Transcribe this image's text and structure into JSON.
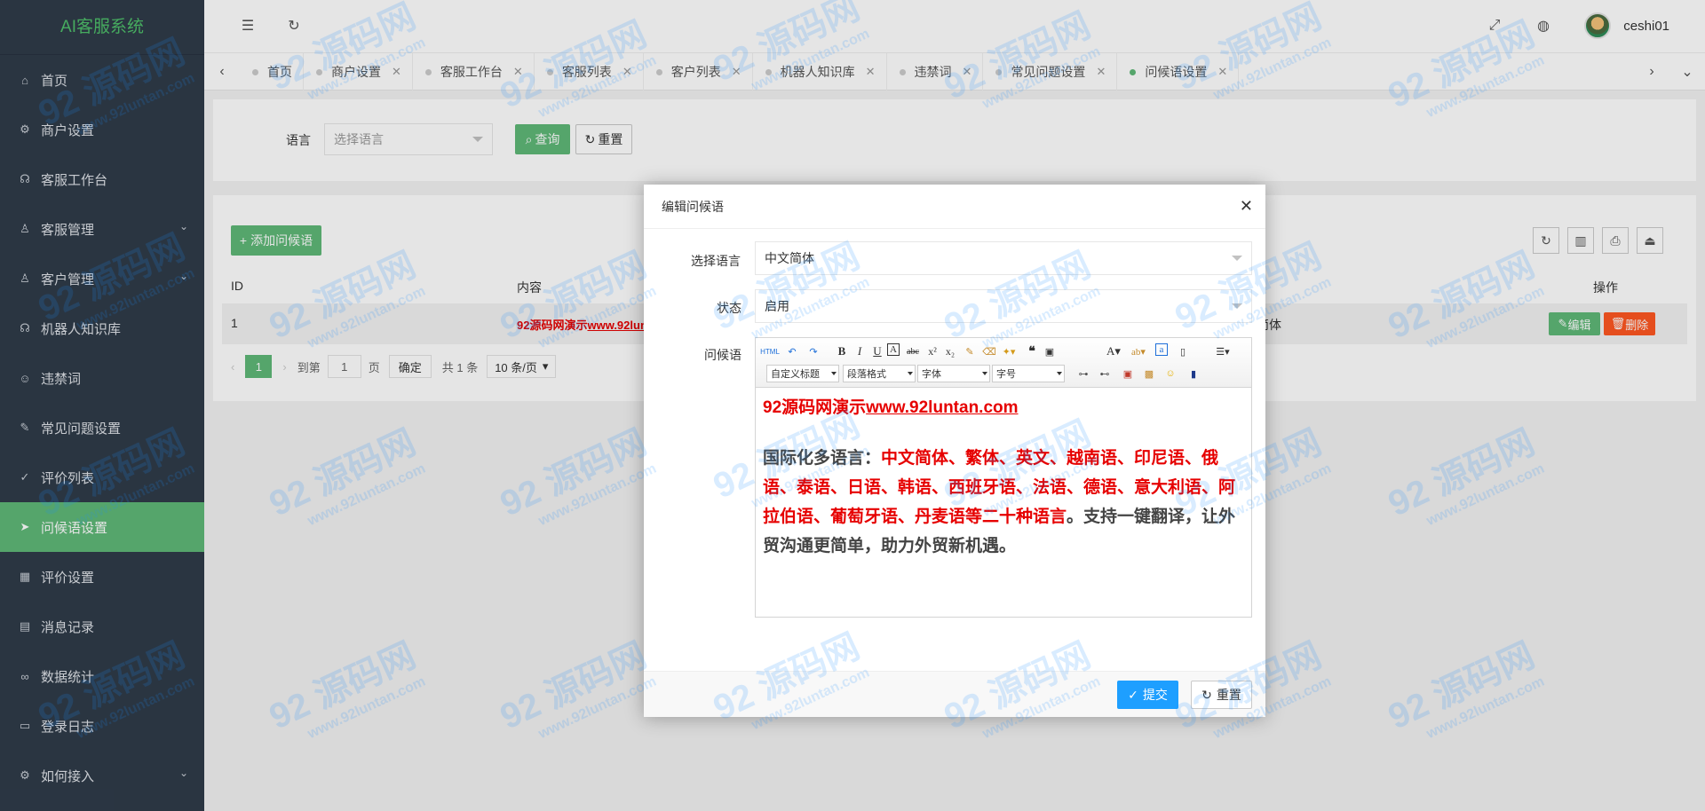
{
  "app": {
    "title": "AI客服系统"
  },
  "sidebar": {
    "items": [
      {
        "label": "首页",
        "icon": "home-icon",
        "glyph": "⌂",
        "has_children": false
      },
      {
        "label": "商户设置",
        "icon": "gear-icon",
        "glyph": "⚙",
        "has_children": false
      },
      {
        "label": "客服工作台",
        "icon": "headset-icon",
        "glyph": "☊",
        "has_children": false
      },
      {
        "label": "客服管理",
        "icon": "user-icon",
        "glyph": "♙",
        "has_children": true
      },
      {
        "label": "客户管理",
        "icon": "users-icon",
        "glyph": "♙",
        "has_children": true
      },
      {
        "label": "机器人知识库",
        "icon": "robot-icon",
        "glyph": "☊",
        "has_children": false
      },
      {
        "label": "违禁词",
        "icon": "smile-icon",
        "glyph": "☺",
        "has_children": false
      },
      {
        "label": "常见问题设置",
        "icon": "edit-icon",
        "glyph": "✎",
        "has_children": false
      },
      {
        "label": "评价列表",
        "icon": "thumb-icon",
        "glyph": "✓",
        "has_children": false
      },
      {
        "label": "问候语设置",
        "icon": "send-icon",
        "glyph": "➤",
        "has_children": false,
        "active": true
      },
      {
        "label": "评价设置",
        "icon": "calendar-icon",
        "glyph": "▦",
        "has_children": false
      },
      {
        "label": "消息记录",
        "icon": "note-icon",
        "glyph": "▤",
        "has_children": false
      },
      {
        "label": "数据统计",
        "icon": "link-icon",
        "glyph": "∞",
        "has_children": false
      },
      {
        "label": "登录日志",
        "icon": "log-icon",
        "glyph": "▭",
        "has_children": false
      },
      {
        "label": "如何接入",
        "icon": "plug-icon",
        "glyph": "⚙",
        "has_children": true
      }
    ]
  },
  "header": {
    "username": "ceshi01"
  },
  "tabs": [
    {
      "label": "首页",
      "closable": false
    },
    {
      "label": "商户设置",
      "closable": true
    },
    {
      "label": "客服工作台",
      "closable": true
    },
    {
      "label": "客服列表",
      "closable": true
    },
    {
      "label": "客户列表",
      "closable": true
    },
    {
      "label": "机器人知识库",
      "closable": true
    },
    {
      "label": "违禁词",
      "closable": true
    },
    {
      "label": "常见问题设置",
      "closable": true
    },
    {
      "label": "问候语设置",
      "closable": true,
      "active": true
    }
  ],
  "search": {
    "language_label": "语言",
    "language_placeholder": "选择语言",
    "query_button": "查询",
    "reset_button": "重置"
  },
  "list": {
    "add_button": "添加问候语",
    "columns": {
      "id": "ID",
      "content": "内容",
      "action": "操作"
    },
    "rows": [
      {
        "id": "1",
        "content": "92源码网演示",
        "content_link": "www.92lun",
        "language": "简体",
        "edit": "编辑",
        "delete": "删除"
      }
    ],
    "pager": {
      "current": "1",
      "goto_label": "到第",
      "page_input": "1",
      "page_unit": "页",
      "confirm": "确定",
      "total": "共 1 条",
      "per_page": "10 条/页"
    }
  },
  "modal": {
    "title": "编辑问候语",
    "language_label": "选择语言",
    "language_value": "中文简体",
    "status_label": "状态",
    "status_value": "启用",
    "greeting_label": "问候语",
    "editor": {
      "toolbar_combos": [
        "自定义标题",
        "段落格式",
        "字体",
        "字号"
      ],
      "line1_text": "92源码网演示",
      "line1_link": "www.92luntan.com",
      "p_lead": "国际化多语言：",
      "p_langs": "中文简体、繁体、英文、越南语、印尼语、俄语、泰语、日语、韩语、西班牙语、法语、德语、意大利语、阿拉伯语、葡萄牙语、丹麦语等二十种语言",
      "p_tail": "。支持一键翻译，让外贸沟通更简单，助力外贸新机遇。"
    },
    "submit_button": "提交",
    "reset_button": "重置"
  },
  "watermark": {
    "text": "92 源码网",
    "url": "www.92luntan.com"
  },
  "colors": {
    "sidebar_bg": "#2f3b49",
    "accent_green": "#5fb878",
    "primary_blue": "#1e9fff",
    "danger": "#ff5722",
    "brand_text": "#4fbf6a"
  }
}
